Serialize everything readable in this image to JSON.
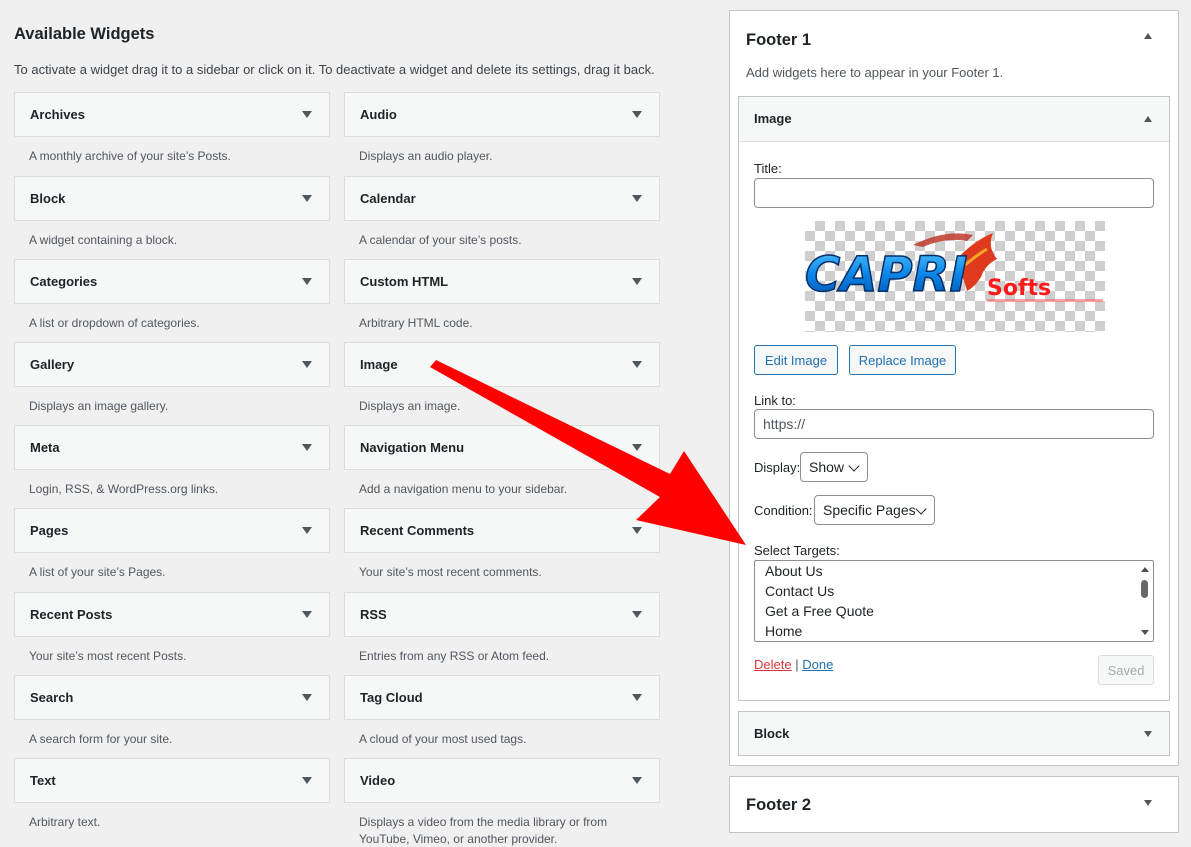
{
  "available": {
    "title": "Available Widgets",
    "description": "To activate a widget drag it to a sidebar or click on it. To deactivate a widget and delete its settings, drag it back.",
    "widgets": [
      {
        "name": "Archives",
        "desc": "A monthly archive of your site’s Posts."
      },
      {
        "name": "Audio",
        "desc": "Displays an audio player."
      },
      {
        "name": "Block",
        "desc": "A widget containing a block."
      },
      {
        "name": "Calendar",
        "desc": "A calendar of your site’s posts."
      },
      {
        "name": "Categories",
        "desc": "A list or dropdown of categories."
      },
      {
        "name": "Custom HTML",
        "desc": "Arbitrary HTML code."
      },
      {
        "name": "Gallery",
        "desc": "Displays an image gallery."
      },
      {
        "name": "Image",
        "desc": "Displays an image."
      },
      {
        "name": "Meta",
        "desc": "Login, RSS, & WordPress.org links."
      },
      {
        "name": "Navigation Menu",
        "desc": "Add a navigation menu to your sidebar."
      },
      {
        "name": "Pages",
        "desc": "A list of your site’s Pages."
      },
      {
        "name": "Recent Comments",
        "desc": "Your site’s most recent comments."
      },
      {
        "name": "Recent Posts",
        "desc": "Your site’s most recent Posts."
      },
      {
        "name": "RSS",
        "desc": "Entries from any RSS or Atom feed."
      },
      {
        "name": "Search",
        "desc": "A search form for your site."
      },
      {
        "name": "Tag Cloud",
        "desc": "A cloud of your most used tags."
      },
      {
        "name": "Text",
        "desc": "Arbitrary text."
      },
      {
        "name": "Video",
        "desc": "Displays a video from the media library or from YouTube, Vimeo, or another provider."
      }
    ]
  },
  "footer1": {
    "title": "Footer 1",
    "description": "Add widgets here to appear in your Footer 1.",
    "image_widget": {
      "header": "Image",
      "title_label": "Title:",
      "title_value": "",
      "logo_text_main": "CAPRI",
      "logo_text_sub": "Softs",
      "edit_image_label": "Edit Image",
      "replace_image_label": "Replace Image",
      "link_label": "Link to:",
      "link_value": "https://",
      "display_label": "Display:",
      "display_value": "Show",
      "condition_label": "Condition:",
      "condition_value": "Specific Pages",
      "targets_label": "Select Targets:",
      "targets": [
        "About Us",
        "Contact Us",
        "Get a Free Quote",
        "Home"
      ],
      "delete_label": "Delete",
      "separator": "|",
      "done_label": "Done",
      "saved_label": "Saved"
    },
    "block_widget": {
      "header": "Block"
    }
  },
  "footer2": {
    "title": "Footer 2"
  },
  "colors": {
    "accent": "#2271b1",
    "danger": "#d63638",
    "arrow": "#ff0000"
  }
}
